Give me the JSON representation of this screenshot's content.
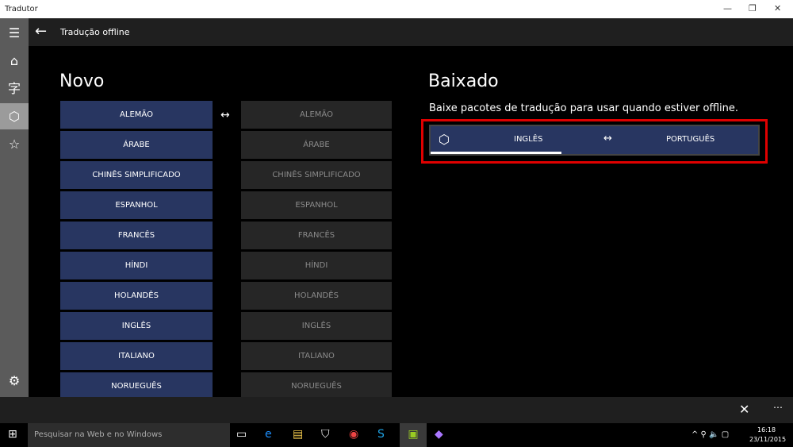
{
  "window": {
    "title": "Tradutor"
  },
  "header": {
    "title": "Tradução offline"
  },
  "novo": {
    "heading": "Novo",
    "swap": "↔",
    "left": [
      "ALEMÃO",
      "ÁRABE",
      "CHINÊS SIMPLIFICADO",
      "ESPANHOL",
      "FRANCÊS",
      "HÍNDI",
      "HOLANDÊS",
      "INGLÊS",
      "ITALIANO",
      "NORUEGUÊS"
    ],
    "right": [
      "ALEMÃO",
      "ÁRABE",
      "CHINÊS SIMPLIFICADO",
      "ESPANHOL",
      "FRANCÊS",
      "HÍNDI",
      "HOLANDÊS",
      "INGLÊS",
      "ITALIANO",
      "NORUEGUÊS"
    ]
  },
  "baixado": {
    "heading": "Baixado",
    "description": "Baixe pacotes de tradução para usar quando estiver offline.",
    "package": {
      "from": "INGLÊS",
      "swap": "↔",
      "to": "PORTUGUÊS",
      "progress": 0.4
    }
  },
  "taskbar": {
    "search_placeholder": "Pesquisar na Web e no Windows",
    "time": "16:18",
    "date": "23/11/2015"
  },
  "colors": {
    "accent": "#283661",
    "highlight": "#e00000"
  }
}
